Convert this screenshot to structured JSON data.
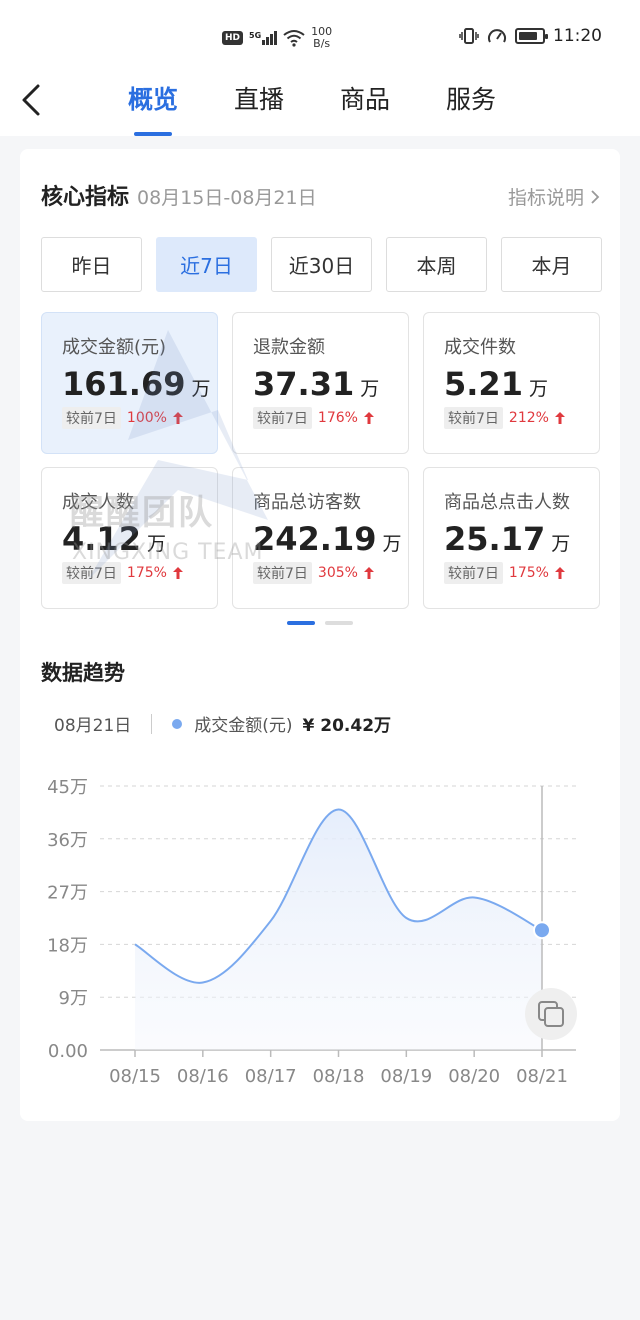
{
  "status_bar": {
    "hd": "HD",
    "signal": "5G",
    "net_speed_value": "100",
    "net_speed_unit": "B/s",
    "time": "11:20",
    "battery_level": 0.8
  },
  "nav": {
    "tabs": [
      {
        "label": "概览",
        "active": true
      },
      {
        "label": "直播",
        "active": false
      },
      {
        "label": "商品",
        "active": false
      },
      {
        "label": "服务",
        "active": false
      }
    ]
  },
  "core": {
    "title": "核心指标",
    "range": "08月15日-08月21日",
    "link": "指标说明",
    "periods": [
      "昨日",
      "近7日",
      "近30日",
      "本周",
      "本月"
    ],
    "active_period": 1,
    "metrics": [
      {
        "label": "成交金额(元)",
        "value": "161.69",
        "unit": "万",
        "compare": "较前7日",
        "pct": "100%"
      },
      {
        "label": "退款金额",
        "value": "37.31",
        "unit": "万",
        "compare": "较前7日",
        "pct": "176%"
      },
      {
        "label": "成交件数",
        "value": "5.21",
        "unit": "万",
        "compare": "较前7日",
        "pct": "212%"
      },
      {
        "label": "成交人数",
        "value": "4.12",
        "unit": "万",
        "compare": "较前7日",
        "pct": "175%"
      },
      {
        "label": "商品总访客数",
        "value": "242.19",
        "unit": "万",
        "compare": "较前7日",
        "pct": "305%"
      },
      {
        "label": "商品总点击人数",
        "value": "25.17",
        "unit": "万",
        "compare": "较前7日",
        "pct": "175%"
      }
    ]
  },
  "trend": {
    "title": "数据趋势",
    "selected_date": "08月21日",
    "series_label": "成交金额(元)",
    "selected_value": "¥ 20.42万"
  },
  "watermark": {
    "text": "醒醒团队",
    "sub": "XINGXING TEAM"
  },
  "colors": {
    "accent": "#2b6fe0",
    "up": "#e0393e",
    "line": "#7aa9ef"
  },
  "chart_data": {
    "type": "area",
    "x": [
      "08/15",
      "08/16",
      "08/17",
      "08/18",
      "08/19",
      "08/20",
      "08/21"
    ],
    "y_tick_labels": [
      "0.00",
      "9万",
      "18万",
      "27万",
      "36万",
      "45万"
    ],
    "y_ticks": [
      0,
      9,
      18,
      27,
      36,
      45
    ],
    "ylim": [
      0,
      45
    ],
    "series": [
      {
        "values": [
          18.0,
          11.5,
          22.0,
          41.0,
          22.5,
          26.0,
          20.42
        ]
      }
    ],
    "highlight_index": 6,
    "grid": true
  }
}
